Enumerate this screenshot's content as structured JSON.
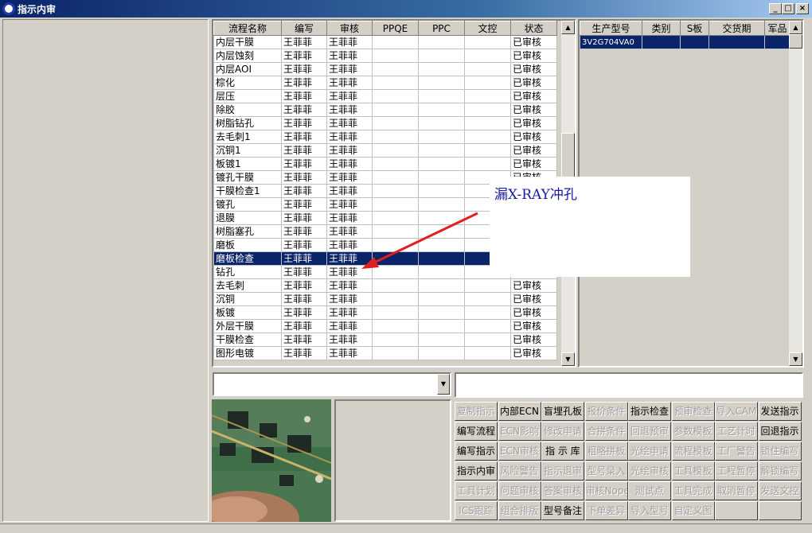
{
  "window": {
    "title": "指示内审"
  },
  "main_grid": {
    "columns": [
      "流程名称",
      "编写",
      "审核",
      "PPQE",
      "PPC",
      "文控",
      "状态"
    ],
    "rows": [
      {
        "name": "内层干膜",
        "writer": "王菲菲",
        "reviewer": "王菲菲",
        "ppqe": "",
        "ppc": "",
        "doc": "",
        "status": "已审核"
      },
      {
        "name": "内层蚀刻",
        "writer": "王菲菲",
        "reviewer": "王菲菲",
        "ppqe": "",
        "ppc": "",
        "doc": "",
        "status": "已审核"
      },
      {
        "name": "内层AOI",
        "writer": "王菲菲",
        "reviewer": "王菲菲",
        "ppqe": "",
        "ppc": "",
        "doc": "",
        "status": "已审核"
      },
      {
        "name": "棕化",
        "writer": "王菲菲",
        "reviewer": "王菲菲",
        "ppqe": "",
        "ppc": "",
        "doc": "",
        "status": "已审核"
      },
      {
        "name": "层压",
        "writer": "王菲菲",
        "reviewer": "王菲菲",
        "ppqe": "",
        "ppc": "",
        "doc": "",
        "status": "已审核"
      },
      {
        "name": "除胶",
        "writer": "王菲菲",
        "reviewer": "王菲菲",
        "ppqe": "",
        "ppc": "",
        "doc": "",
        "status": "已审核"
      },
      {
        "name": "树脂钻孔",
        "writer": "王菲菲",
        "reviewer": "王菲菲",
        "ppqe": "",
        "ppc": "",
        "doc": "",
        "status": "已审核"
      },
      {
        "name": "去毛刺1",
        "writer": "王菲菲",
        "reviewer": "王菲菲",
        "ppqe": "",
        "ppc": "",
        "doc": "",
        "status": "已审核"
      },
      {
        "name": "沉铜1",
        "writer": "王菲菲",
        "reviewer": "王菲菲",
        "ppqe": "",
        "ppc": "",
        "doc": "",
        "status": "已审核"
      },
      {
        "name": "板镀1",
        "writer": "王菲菲",
        "reviewer": "王菲菲",
        "ppqe": "",
        "ppc": "",
        "doc": "",
        "status": "已审核"
      },
      {
        "name": "镀孔干膜",
        "writer": "王菲菲",
        "reviewer": "王菲菲",
        "ppqe": "",
        "ppc": "",
        "doc": "",
        "status": "已审核"
      },
      {
        "name": "干膜检查1",
        "writer": "王菲菲",
        "reviewer": "王菲菲",
        "ppqe": "",
        "ppc": "",
        "doc": "",
        "status": ""
      },
      {
        "name": "镀孔",
        "writer": "王菲菲",
        "reviewer": "王菲菲",
        "ppqe": "",
        "ppc": "",
        "doc": "",
        "status": ""
      },
      {
        "name": "退膜",
        "writer": "王菲菲",
        "reviewer": "王菲菲",
        "ppqe": "",
        "ppc": "",
        "doc": "",
        "status": ""
      },
      {
        "name": "树脂塞孔",
        "writer": "王菲菲",
        "reviewer": "王菲菲",
        "ppqe": "",
        "ppc": "",
        "doc": "",
        "status": ""
      },
      {
        "name": "磨板",
        "writer": "王菲菲",
        "reviewer": "王菲菲",
        "ppqe": "",
        "ppc": "",
        "doc": "",
        "status": ""
      },
      {
        "name": "磨板检查",
        "writer": "王菲菲",
        "reviewer": "王菲菲",
        "ppqe": "",
        "ppc": "",
        "doc": "",
        "status": ""
      },
      {
        "name": "钻孔",
        "writer": "王菲菲",
        "reviewer": "王菲菲",
        "ppqe": "",
        "ppc": "",
        "doc": "",
        "status": ""
      },
      {
        "name": "去毛刺",
        "writer": "王菲菲",
        "reviewer": "王菲菲",
        "ppqe": "",
        "ppc": "",
        "doc": "",
        "status": "已审核"
      },
      {
        "name": "沉铜",
        "writer": "王菲菲",
        "reviewer": "王菲菲",
        "ppqe": "",
        "ppc": "",
        "doc": "",
        "status": "已审核"
      },
      {
        "name": "板镀",
        "writer": "王菲菲",
        "reviewer": "王菲菲",
        "ppqe": "",
        "ppc": "",
        "doc": "",
        "status": "已审核"
      },
      {
        "name": "外层干膜",
        "writer": "王菲菲",
        "reviewer": "王菲菲",
        "ppqe": "",
        "ppc": "",
        "doc": "",
        "status": "已审核"
      },
      {
        "name": "干膜检查",
        "writer": "王菲菲",
        "reviewer": "王菲菲",
        "ppqe": "",
        "ppc": "",
        "doc": "",
        "status": "已审核"
      },
      {
        "name": "图形电镀",
        "writer": "王菲菲",
        "reviewer": "王菲菲",
        "ppqe": "",
        "ppc": "",
        "doc": "",
        "status": "已审核"
      }
    ],
    "selected_row": 16,
    "scroll_position": 0.4
  },
  "right_grid": {
    "columns": [
      "生产型号",
      "类别",
      "S板",
      "交货期",
      "军品"
    ],
    "rows": [
      {
        "model": "3V2G704VA0",
        "category": "",
        "sboard": "",
        "delivery": "",
        "military": ""
      }
    ],
    "selected_row": 0
  },
  "inputs": {
    "combo_value": "",
    "text_value": ""
  },
  "annotation": {
    "text": "漏X-RAY冲孔",
    "text_color": "#1a1aa0",
    "arrow_color": "#e02020"
  },
  "buttons": [
    [
      {
        "label": "复制指示",
        "enabled": false
      },
      {
        "label": "内部ECN",
        "enabled": true
      },
      {
        "label": "盲埋孔板",
        "enabled": true
      },
      {
        "label": "报价条件",
        "enabled": false
      },
      {
        "label": "指示检查",
        "enabled": true
      },
      {
        "label": "预审检查",
        "enabled": false
      },
      {
        "label": "导入CAM",
        "enabled": false
      },
      {
        "label": "发送指示",
        "enabled": true
      }
    ],
    [
      {
        "label": "编写流程",
        "enabled": true
      },
      {
        "label": "ECN影响",
        "enabled": false
      },
      {
        "label": "修改申请",
        "enabled": false
      },
      {
        "label": "合拼条件",
        "enabled": false
      },
      {
        "label": "回退预审",
        "enabled": false
      },
      {
        "label": "参数模板",
        "enabled": false
      },
      {
        "label": "工艺计时",
        "enabled": false
      },
      {
        "label": "回退指示",
        "enabled": true
      }
    ],
    [
      {
        "label": "编写指示",
        "enabled": true
      },
      {
        "label": "ECN审核",
        "enabled": false
      },
      {
        "label": "指 示 库",
        "enabled": true
      },
      {
        "label": "粗略拼板",
        "enabled": false
      },
      {
        "label": "光绘申请",
        "enabled": false
      },
      {
        "label": "流程模板",
        "enabled": false
      },
      {
        "label": "工厂警告",
        "enabled": false
      },
      {
        "label": "锁住编写",
        "enabled": false
      }
    ],
    [
      {
        "label": "指示内审",
        "enabled": true
      },
      {
        "label": "风险警告",
        "enabled": false
      },
      {
        "label": "指示退审",
        "enabled": false
      },
      {
        "label": "型号录入",
        "enabled": false
      },
      {
        "label": "光绘审核",
        "enabled": false
      },
      {
        "label": "工具模板",
        "enabled": false
      },
      {
        "label": "工程暂停",
        "enabled": false
      },
      {
        "label": "解锁编写",
        "enabled": false
      }
    ],
    [
      {
        "label": "工具计划",
        "enabled": false
      },
      {
        "label": "问题审核",
        "enabled": false
      },
      {
        "label": "答案审核",
        "enabled": false
      },
      {
        "label": "审核Nope",
        "enabled": false
      },
      {
        "label": "测试点",
        "enabled": false
      },
      {
        "label": "工具完成",
        "enabled": false
      },
      {
        "label": "取消暂停",
        "enabled": false
      },
      {
        "label": "发送文控",
        "enabled": false
      }
    ],
    [
      {
        "label": "ICS跟踪",
        "enabled": false
      },
      {
        "label": "组合排版",
        "enabled": false
      },
      {
        "label": "型号备注",
        "enabled": true
      },
      {
        "label": "下单差异",
        "enabled": false
      },
      {
        "label": "导入型号",
        "enabled": false
      },
      {
        "label": "自定义图",
        "enabled": false
      },
      {
        "label": "",
        "enabled": false
      },
      {
        "label": "",
        "enabled": false
      }
    ]
  ]
}
